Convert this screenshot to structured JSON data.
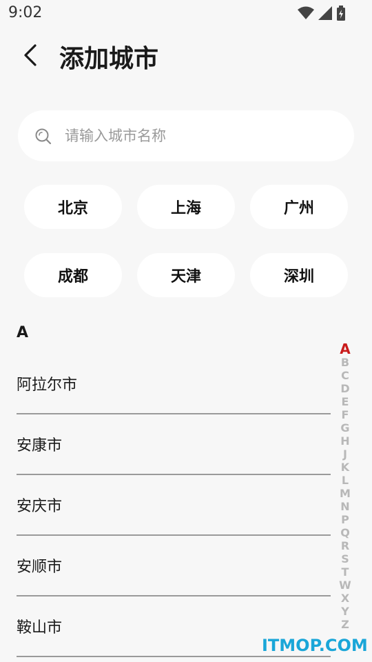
{
  "status_bar": {
    "time": "9:02"
  },
  "header": {
    "title": "添加城市"
  },
  "search": {
    "placeholder": "请输入城市名称"
  },
  "hot_cities": [
    "北京",
    "上海",
    "广州",
    "成都",
    "天津",
    "深圳"
  ],
  "section": {
    "letter": "A"
  },
  "cities": [
    "阿拉尔市",
    "安康市",
    "安庆市",
    "安顺市",
    "鞍山市"
  ],
  "index_letters": [
    "A",
    "B",
    "C",
    "D",
    "E",
    "F",
    "G",
    "H",
    "J",
    "K",
    "L",
    "M",
    "N",
    "P",
    "Q",
    "R",
    "S",
    "T",
    "W",
    "X",
    "Y",
    "Z"
  ],
  "active_index": "A",
  "colors": {
    "accent": "#c91b1b",
    "background": "#f7f7f7",
    "chip": "#ffffff",
    "watermark": "#1aa6d8"
  },
  "watermark": "ITMOP.COM"
}
